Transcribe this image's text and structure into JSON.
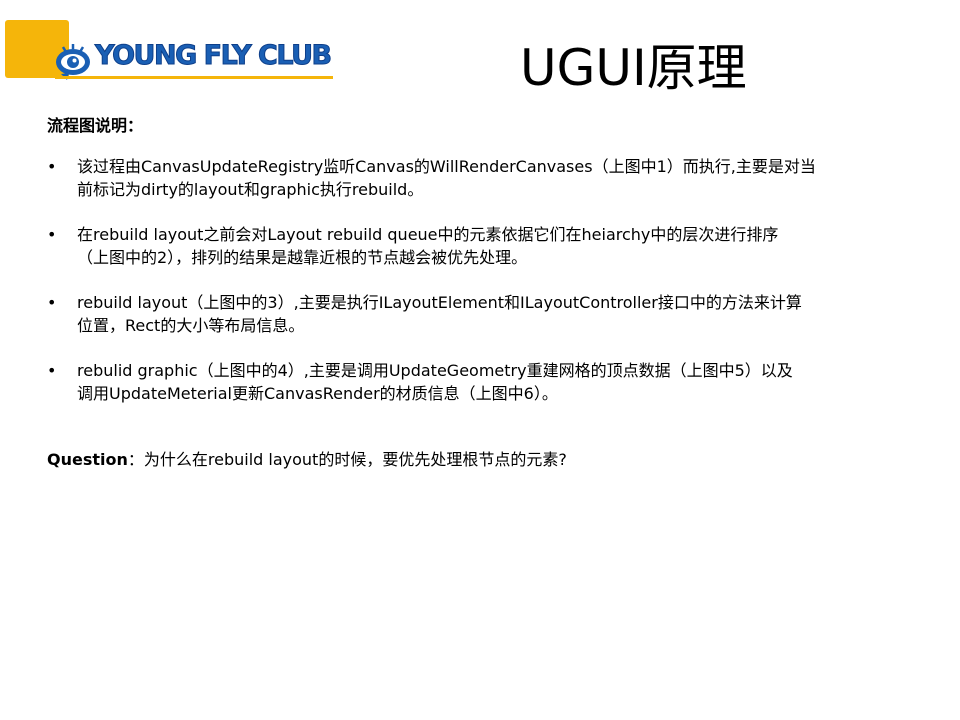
{
  "logo": {
    "text": "YOUNG FLY CLUB",
    "colors": {
      "yellow": "#f5b50a",
      "blue": "#1a5fb4"
    }
  },
  "header": {
    "title": "UGUI原理"
  },
  "content": {
    "heading": "流程图说明：",
    "bullets": [
      {
        "line1": "该过程由CanvasUpdateRegistry监听Canvas的WillRenderCanvases（上图中1）而执行,主要是对当",
        "line2": "前标记为dirty的layout和graphic执行rebuild。"
      },
      {
        "line1": "在rebuild layout之前会对Layout rebuild queue中的元素依据它们在heiarchy中的层次进行排序",
        "line2": "（上图中的2），排列的结果是越靠近根的节点越会被优先处理。"
      },
      {
        "line1": "rebuild layout（上图中的3）,主要是执行ILayoutElement和ILayoutController接口中的方法来计算",
        "line2": "位置，Rect的大小等布局信息。"
      },
      {
        "line1": "rebulid graphic（上图中的4）,主要是调用UpdateGeometry重建网格的顶点数据（上图中5）以及",
        "line2": "调用UpdateMeterial更新CanvasRender的材质信息（上图中6）。"
      }
    ],
    "bullet_char": "•",
    "question_label": "Question",
    "question_text": "：为什么在rebuild layout的时候，要优先处理根节点的元素?"
  }
}
